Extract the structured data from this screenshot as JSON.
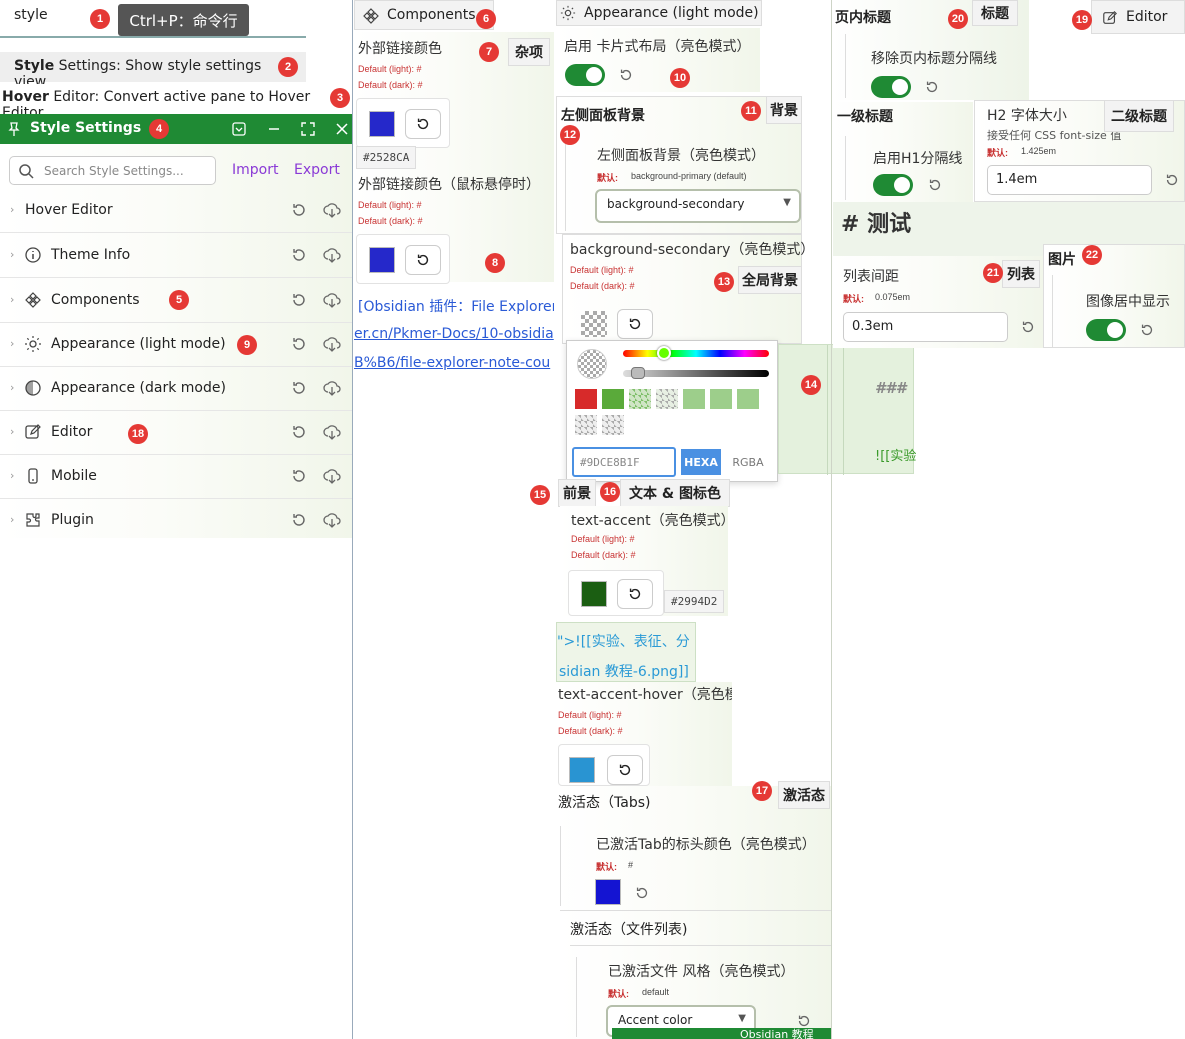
{
  "colors": {
    "accent": "#1f8a34",
    "badge": "#e53935",
    "link": "#2a5ad6",
    "purple": "#8a3ad6"
  },
  "badges": [
    "1",
    "2",
    "3",
    "4",
    "5",
    "6",
    "7",
    "8",
    "9",
    "10",
    "11",
    "12",
    "13",
    "14",
    "15",
    "16",
    "17",
    "18",
    "19",
    "20",
    "21",
    "22"
  ],
  "command": {
    "query": "style",
    "tooltip": "Ctrl+P：命令行",
    "items": [
      {
        "bold": "Style",
        "rest": " Settings: Show style settings view"
      },
      {
        "bold": "Hover",
        "rest": " Editor: Convert active pane to Hover Editor"
      }
    ]
  },
  "style_settings": {
    "title": "Style Settings",
    "search_placeholder": "Search Style Settings...",
    "import": "Import",
    "export": "Export",
    "items": [
      {
        "label": "Hover Editor",
        "icon": "none"
      },
      {
        "label": "Theme Info",
        "icon": "info-icon"
      },
      {
        "label": "Components",
        "icon": "components-icon"
      },
      {
        "label": "Appearance (light mode)",
        "icon": "sun-icon"
      },
      {
        "label": "Appearance (dark mode)",
        "icon": "moon-icon"
      },
      {
        "label": "Editor",
        "icon": "edit-icon"
      },
      {
        "label": "Mobile",
        "icon": "mobile-icon"
      },
      {
        "label": "Plugin",
        "icon": "plugin-icon"
      }
    ]
  },
  "components": {
    "header": "Components",
    "tag": "杂项",
    "link_color": {
      "title": "外部链接颜色",
      "default_light": "Default (light): #",
      "default_dark": "Default (dark): #",
      "hex": "#2528CA",
      "swatch": "#2528ca"
    },
    "link_hover": {
      "title": "外部链接颜色（鼠标悬停时）",
      "default_light": "Default (light): #",
      "default_dark": "Default (dark): #",
      "swatch": "#2528ca"
    },
    "links": [
      "[Obsidian 插件：File Explorer",
      "er.cn/Pkmer-Docs/10-obsidia",
      "B%B6/file-explorer-note-cou"
    ]
  },
  "appearance": {
    "header": "Appearance (light mode)",
    "card_layout": "启用 卡片式布局（亮色模式）",
    "left_bg": {
      "title": "左侧面板背景",
      "tag": "背景",
      "setting": "左侧面板背景（亮色模式）",
      "default_label": "默认:",
      "default_value": "background-primary (default)",
      "selected": "background-secondary"
    },
    "bg_secondary": {
      "title": "background-secondary（亮色模式）",
      "tag": "全局背景",
      "default_light": "Default (light): #",
      "default_dark": "Default (dark): #"
    },
    "picker": {
      "hex_value": "#9DCE8B1F",
      "mode_hexa": "HEXA",
      "mode_rgba": "RGBA",
      "preset_swatches": [
        "#d72a2a",
        "#5aaa3a",
        "#7fbf6a",
        "#7fbf6a",
        "#9dce8b",
        "#9dce8b",
        "#9dce8b",
        "#c6c6c6",
        "#c6c6c6"
      ]
    },
    "fg_tag": "前景",
    "text_tag": "文本 & 图标色",
    "text_accent": {
      "title": "text-accent（亮色模式）",
      "default_light": "Default (light): #",
      "default_dark": "Default (dark): #",
      "hex": "#2994D2",
      "swatch": "#1b5e12"
    },
    "snippet": [
      "\">![[实验、表征、分",
      "sidian 教程-6.png]]"
    ],
    "text_accent_hover": {
      "title": "text-accent-hover（亮色模",
      "default_light": "Default (light): #",
      "default_dark": "Default (dark): #",
      "swatch": "#2994d2"
    },
    "preview": {
      "heading": "###",
      "embed": "![[实验"
    },
    "active": {
      "title": "激活态（Tabs)",
      "tag": "激活态",
      "setting": "已激活Tab的标头颜色（亮色模式）",
      "default_label": "默认:",
      "default_value": "#",
      "swatch": "#1414d2"
    },
    "file_active": {
      "title": "激活态（文件列表)",
      "setting": "已激活文件 风格（亮色模式）",
      "default_label": "默认:",
      "default_value": "default",
      "selected": "Accent color",
      "statusbar": "Obsidian 教程"
    }
  },
  "editor": {
    "page_title": "页内标题",
    "tag_title": "标题",
    "editor_tab": "Editor",
    "remove_sep": "移除页内标题分隔线",
    "h1": {
      "title": "一级标题",
      "setting": "启用H1分隔线"
    },
    "h2": {
      "title": "H2 字体大小",
      "desc": "接受任何 CSS font-size 值",
      "default_label": "默认:",
      "default_value": "1.425em",
      "value": "1.4em",
      "tag": "二级标题"
    },
    "test_heading": "# 测试",
    "list": {
      "title": "列表间距",
      "default_label": "默认:",
      "default_value": "0.075em",
      "value": "0.3em",
      "tag": "列表"
    },
    "image": {
      "tag": "图片",
      "setting": "图像居中显示"
    }
  }
}
